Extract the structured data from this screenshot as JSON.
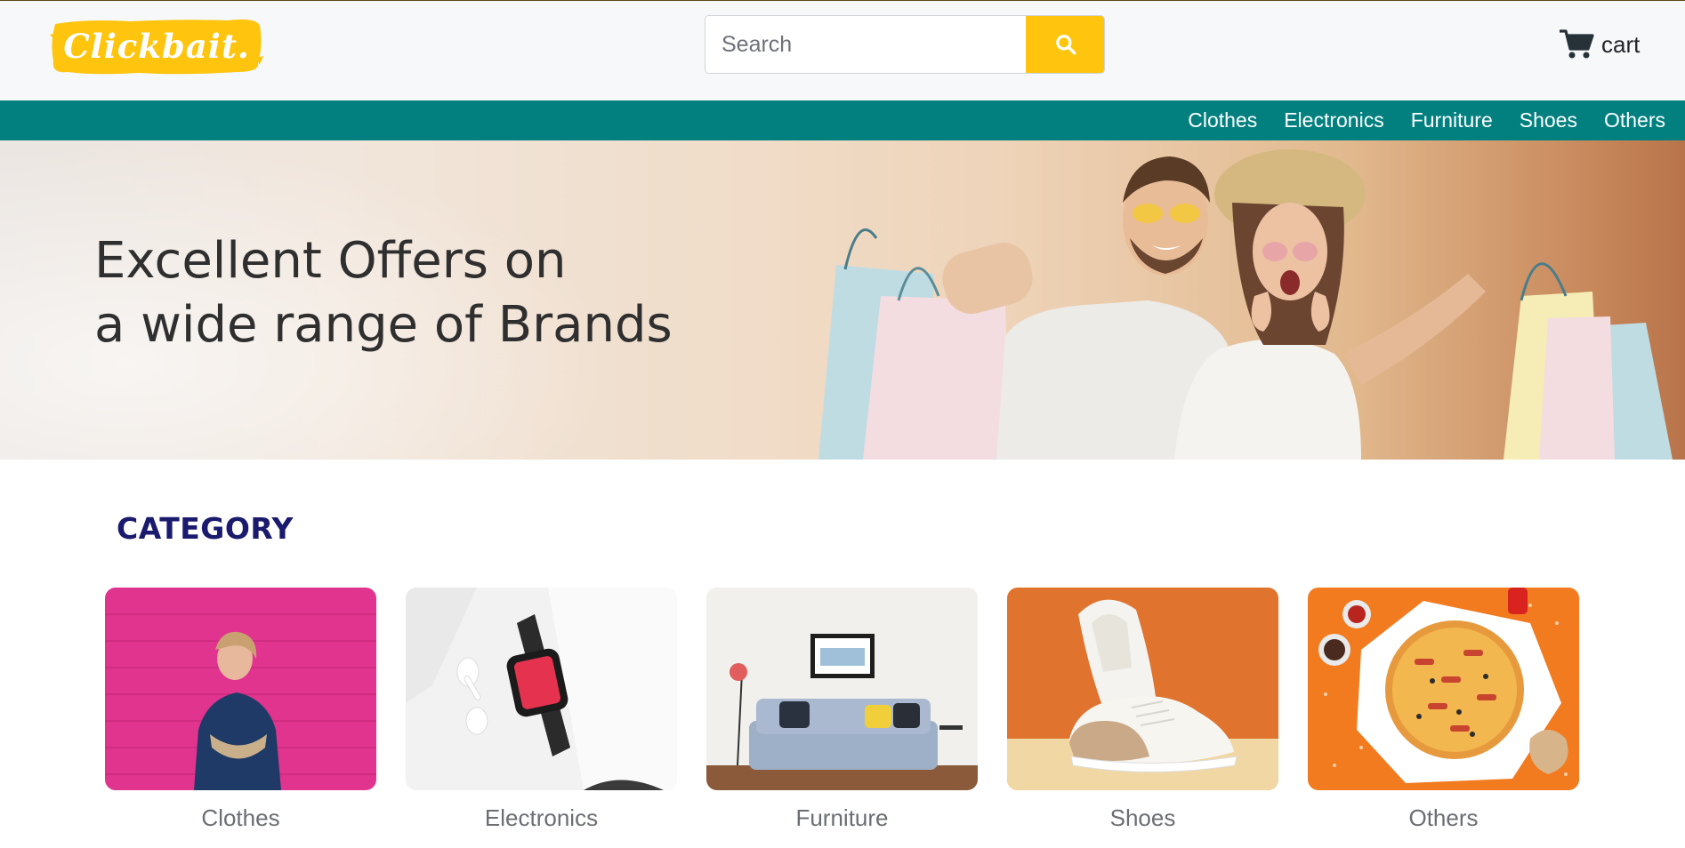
{
  "header": {
    "logo_text": "Clickbait.",
    "search": {
      "placeholder": "Search",
      "button_icon": "search-icon"
    },
    "cart": {
      "label": "cart",
      "icon": "cart-icon"
    }
  },
  "colors": {
    "brand_yellow": "#ffc50e",
    "nav_teal": "#02807f",
    "category_title": "#1a1a6e"
  },
  "nav": {
    "items": [
      {
        "label": "Clothes"
      },
      {
        "label": "Electronics"
      },
      {
        "label": "Furniture"
      },
      {
        "label": "Shoes"
      },
      {
        "label": "Others"
      }
    ]
  },
  "banner": {
    "line1": "Excellent Offers on",
    "line2": "a wide range of Brands"
  },
  "category": {
    "title": "CATEGORY",
    "cards": [
      {
        "label": "Clothes"
      },
      {
        "label": "Electronics"
      },
      {
        "label": "Furniture"
      },
      {
        "label": "Shoes"
      },
      {
        "label": "Others"
      }
    ]
  }
}
